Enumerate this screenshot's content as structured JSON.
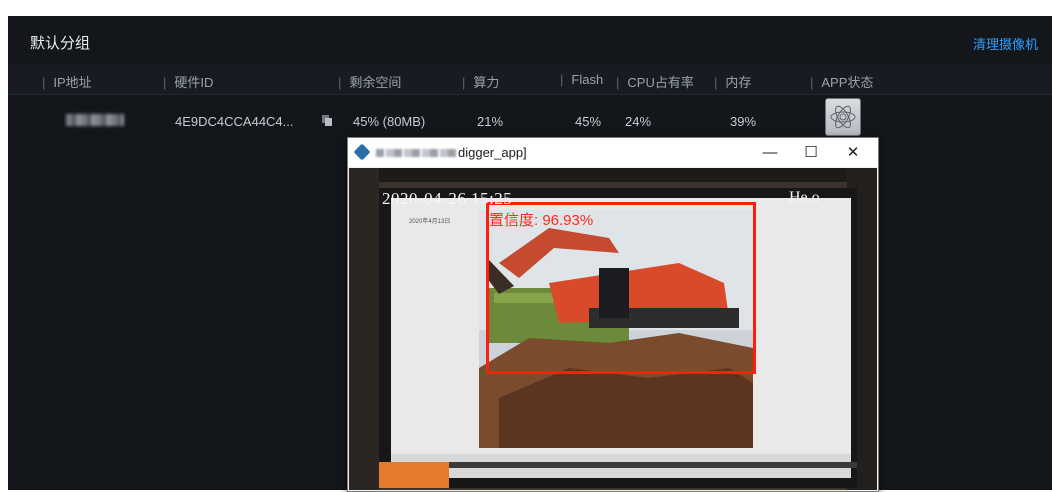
{
  "group": {
    "title": "默认分组",
    "action_label": "清理摄像机"
  },
  "table": {
    "columns": [
      "IP地址",
      "硬件ID",
      "剩余空间",
      "算力",
      "Flash",
      "CPU占有率",
      "内存",
      "APP状态"
    ],
    "rows": [
      {
        "hardware_id": "4E9DC4CCA44C4...",
        "free_space": "45% (80MB)",
        "compute": "21%",
        "flash": "45%",
        "cpu": "24%",
        "memory": "39%"
      }
    ]
  },
  "window": {
    "title": "digger_app]",
    "controls": {
      "minimize": "—",
      "maximize": "☐",
      "close": "✕"
    }
  },
  "video": {
    "timestamp": "2020-04-26 15:25",
    "right_label": "He o",
    "confidence": "置信度: 96.93%",
    "phone_text": "2020年4月13日"
  },
  "colors": {
    "accent": "#2f9fff",
    "detection_box": "#ff1d10",
    "panel_bg": "#13161b"
  }
}
